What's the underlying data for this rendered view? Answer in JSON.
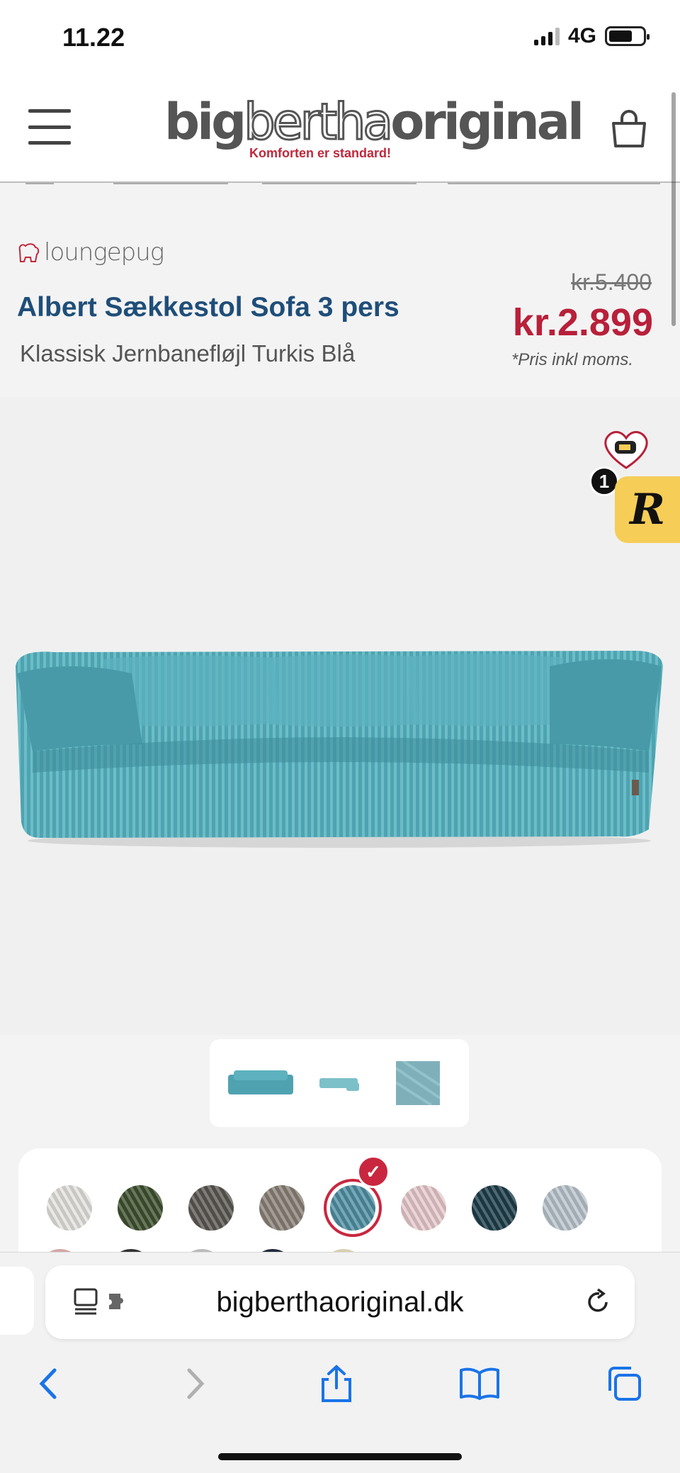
{
  "status_bar": {
    "time": "11.22",
    "network": "4G"
  },
  "header": {
    "logo_big": "big",
    "logo_bertha": "bertha",
    "logo_original": "original",
    "tagline": "Komforten er standard!"
  },
  "product": {
    "brand": "loungepug",
    "title": "Albert Sækkestol Sofa 3 pers",
    "subtitle": "Klassisk Jernbanefløjl Turkis Blå",
    "price_old": "kr.5.400",
    "price_new": "kr.2.899",
    "price_note": "*Pris inkl moms."
  },
  "reward_badge": {
    "count": "1",
    "letter": "R"
  },
  "swatches": {
    "colors": [
      "#e4e2de",
      "#3f5130",
      "#5b5853",
      "#8a8177",
      "#4f8fa3",
      "#e7c9cd",
      "#1e3d4a",
      "#b9c4cc"
    ],
    "selected_index": 4
  },
  "browser": {
    "url": "bigberthaoriginal.dk"
  }
}
